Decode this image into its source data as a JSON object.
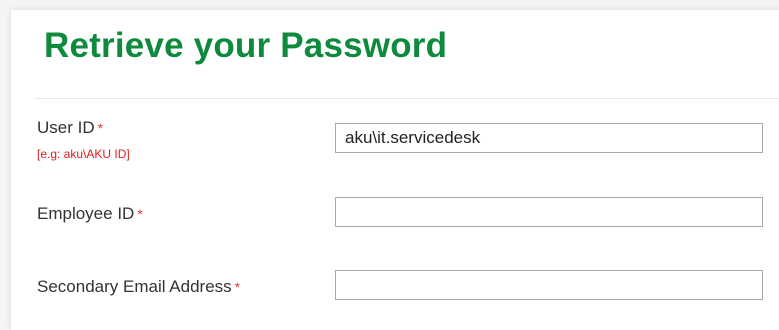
{
  "page": {
    "title": "Retrieve your Password"
  },
  "form": {
    "required_marker": "*",
    "user_id": {
      "label": "User ID",
      "hint": "[e.g: aku\\AKU ID]",
      "value": "aku\\it.servicedesk"
    },
    "employee_id": {
      "label": "Employee ID",
      "value": ""
    },
    "secondary_email": {
      "label": "Secondary Email Address",
      "value": ""
    }
  },
  "colors": {
    "title": "#0e8a3d",
    "required": "#e53935",
    "hint": "#e01a1a"
  }
}
